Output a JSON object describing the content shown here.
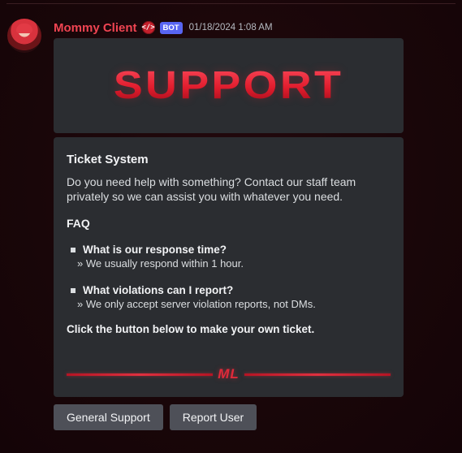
{
  "message": {
    "username": "Mommy Client",
    "dev_badge_icon": "developer-badge-icon",
    "bot_badge": "BOT",
    "timestamp": "01/18/2024 1:08 AM"
  },
  "banner": {
    "text": "SUPPORT"
  },
  "embed": {
    "title": "Ticket System",
    "description": "Do you need help with something? Contact our staff team privately so we can assist you with whatever you need.",
    "faq_heading": "FAQ",
    "faq": [
      {
        "question": "What is our response time?",
        "answer": "» We usually respond within 1 hour."
      },
      {
        "question": "What violations can I report?",
        "answer": "» We only accept server violation reports, not DMs."
      }
    ],
    "cta": "Click the button below to make your own ticket.",
    "divider_logo": "ML"
  },
  "buttons": {
    "general_support": "General Support",
    "report_user": "Report User"
  },
  "colors": {
    "accent": "#e01b2c",
    "username": "#f04452",
    "bot_badge": "#5865f2",
    "embed_bg": "#2b2d31",
    "button_bg": "#4e5058"
  }
}
